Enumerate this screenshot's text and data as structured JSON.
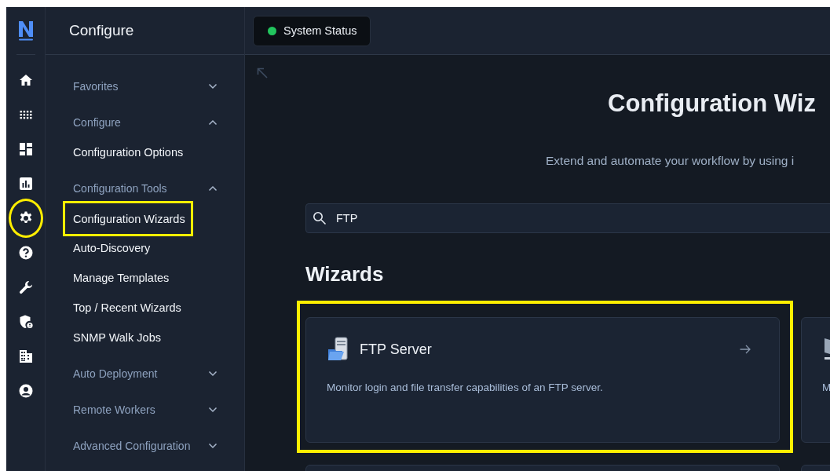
{
  "rail": [
    {
      "kind": "home",
      "highlighted": false
    },
    {
      "kind": "apps",
      "highlighted": false
    },
    {
      "kind": "dashboard",
      "highlighted": false
    },
    {
      "kind": "reports",
      "highlighted": false
    },
    {
      "kind": "settings",
      "highlighted": true
    },
    {
      "kind": "help",
      "highlighted": false
    },
    {
      "kind": "tools",
      "highlighted": false
    },
    {
      "kind": "security",
      "highlighted": false
    },
    {
      "kind": "organization",
      "highlighted": false
    },
    {
      "kind": "account",
      "highlighted": false
    }
  ],
  "sidebar": {
    "title": "Configure",
    "groups": [
      {
        "label": "Favorites",
        "expanded": false
      },
      {
        "label": "Configure",
        "expanded": true,
        "children": [
          {
            "label": "Configuration Options",
            "highlighted": false
          }
        ]
      },
      {
        "label": "Configuration Tools",
        "expanded": true,
        "children": [
          {
            "label": "Configuration Wizards",
            "highlighted": true
          },
          {
            "label": "Auto-Discovery",
            "highlighted": false
          },
          {
            "label": "Manage Templates",
            "highlighted": false
          },
          {
            "label": "Top / Recent Wizards",
            "highlighted": false
          },
          {
            "label": "SNMP Walk Jobs",
            "highlighted": false
          }
        ]
      },
      {
        "label": "Auto Deployment",
        "expanded": false
      },
      {
        "label": "Remote Workers",
        "expanded": false
      },
      {
        "label": "Advanced Configuration",
        "expanded": false
      }
    ]
  },
  "top_bar": {
    "status_button": {
      "label": "System Status",
      "color": "#22c55e"
    }
  },
  "page": {
    "title": "Configuration Wiz",
    "subtitle": "Extend and automate your workflow by using i",
    "search": {
      "value": "FTP"
    },
    "section_title": "Wizards",
    "cards": [
      {
        "kind": "ftp",
        "title": "FTP Server",
        "description": "Monitor login and file transfer capabilities of an FTP server.",
        "highlighted": true
      },
      {
        "kind": "monitor",
        "description": "M",
        "highlighted": false
      },
      {
        "kind": "blank",
        "highlighted": false
      },
      {
        "kind": "blank",
        "highlighted": false
      }
    ]
  }
}
